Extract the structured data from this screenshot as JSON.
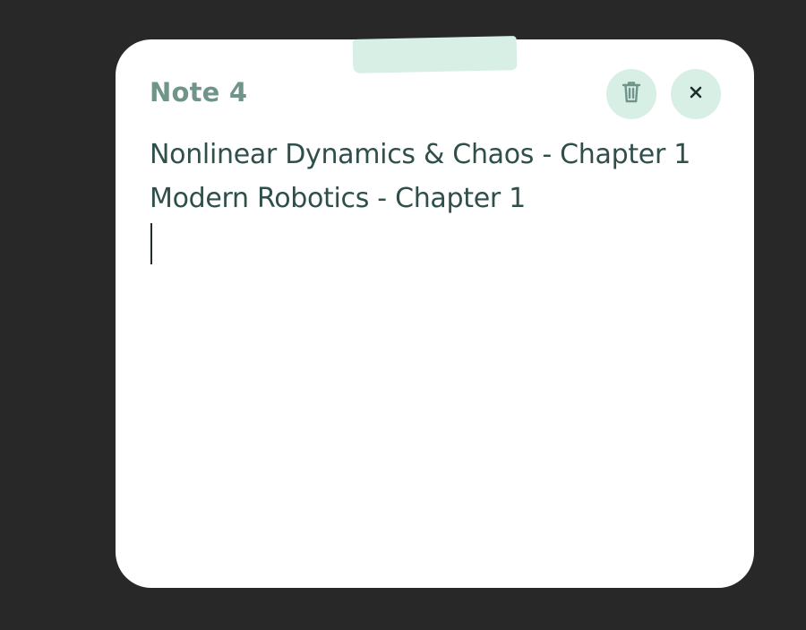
{
  "note": {
    "title": "Note 4",
    "lines": [
      "Nonlinear Dynamics & Chaos - Chapter 1",
      "Modern Robotics - Chapter 1"
    ],
    "actions": {
      "delete_icon": "trash-icon",
      "close_icon": "close-icon"
    }
  },
  "colors": {
    "background": "#282828",
    "card": "#ffffff",
    "accent_light": "#d8efe6",
    "title": "#6f958a",
    "text": "#2f4f4b"
  }
}
